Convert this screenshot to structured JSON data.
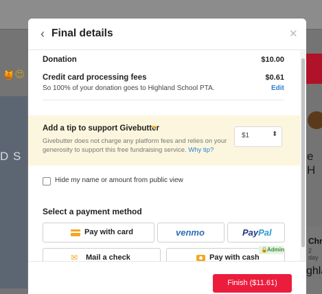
{
  "background": {
    "left_emoji": "🍯😍",
    "left_text": "D S",
    "right_text": "e H",
    "right_name": "Chr",
    "right_time": "2 day",
    "right_bottom": "ghla"
  },
  "modal": {
    "title": "Final details",
    "back_icon": "chevron-left-icon",
    "close_icon": "close-icon",
    "donation": {
      "label": "Donation",
      "amount": "$10.00"
    },
    "fees": {
      "label": "Credit card processing fees",
      "amount": "$0.61",
      "description": "So 100% of your donation goes to Highland School PTA.",
      "edit_label": "Edit"
    },
    "tip": {
      "title": "Add a tip to support Givebutter",
      "heart_icon": "yellow-heart-icon",
      "description": "Givebutter does not charge any platform fees and relies on your generosity to support this free fundraising service.",
      "why_link": "Why tip?",
      "selected_value": "$1"
    },
    "hide_name": {
      "label": "Hide my name or amount from public view",
      "checked": false
    },
    "payment": {
      "title": "Select a payment method",
      "card_label": "Pay with card",
      "venmo_label": "venmo",
      "paypal_a": "Pay",
      "paypal_b": "Pal",
      "check_label": "Mail a check",
      "cash_label": "Pay with cash",
      "admin_label": "Admin"
    },
    "finish_label": "Finish ($11.61)"
  },
  "colors": {
    "accent": "#ec1d3c",
    "link": "#2d7fd3",
    "tip_background": "#fcf6de",
    "admin_green": "#3d8b3a"
  }
}
